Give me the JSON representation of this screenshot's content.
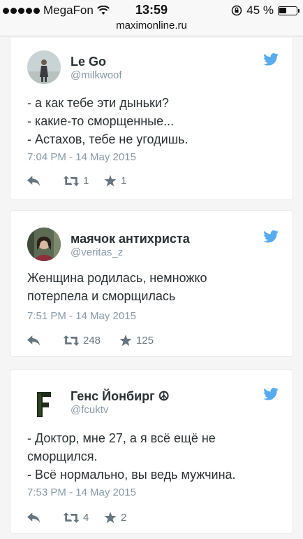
{
  "status": {
    "carrier": "MegaFon",
    "time": "13:59",
    "battery": "45 %",
    "battery_level": 0.45
  },
  "browser": {
    "url": "maximonline.ru"
  },
  "colors": {
    "twitter_blue": "#55acee",
    "gray": "#8899a6"
  },
  "tweets": [
    {
      "name": "Le Go",
      "handle": "@milkwoof",
      "lines": [
        "- а как тебе эти дыньки?",
        "- какие-то сморщенные...",
        "- Астахов, тебе не угодишь."
      ],
      "date": "7:04 PM - 14 May 2015",
      "retweets": "1",
      "favorites": "1"
    },
    {
      "name": "маячок антихриста",
      "handle": "@veritas_z",
      "lines": [
        "Женщина родилась, немножко",
        "потерпела и сморщилась"
      ],
      "date": "7:51 PM - 14 May 2015",
      "retweets": "248",
      "favorites": "125"
    },
    {
      "name": "Генс Йонбирг ☮",
      "handle": "@fcuktv",
      "lines": [
        "- Доктор, мне 27, а я всё ещё не",
        "сморщился.",
        "- Всё нормально, вы ведь мужчина."
      ],
      "date": "7:53 PM - 14 May 2015",
      "retweets": "4",
      "favorites": "2"
    }
  ]
}
